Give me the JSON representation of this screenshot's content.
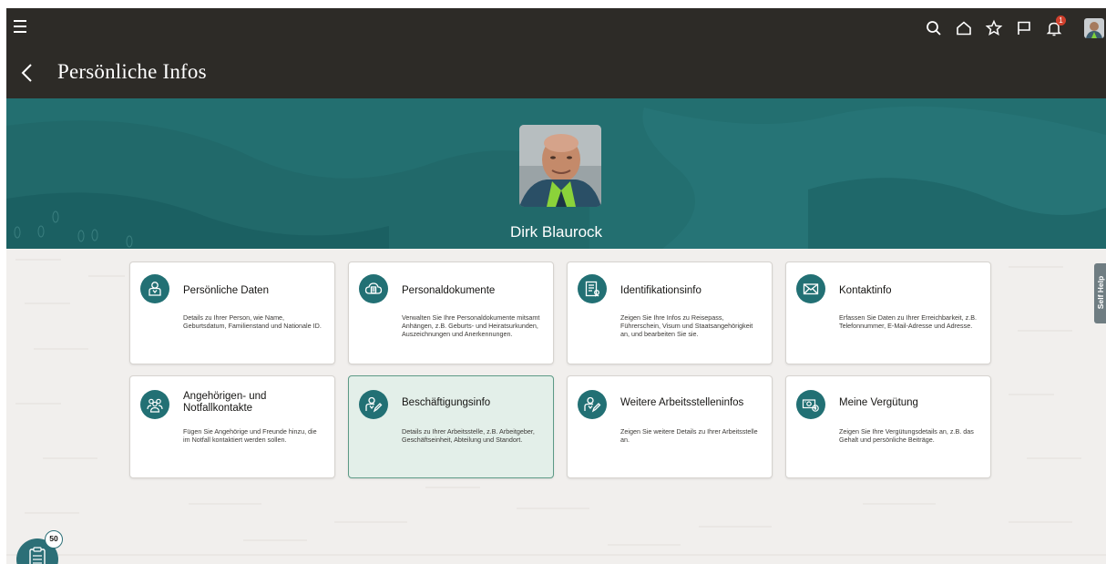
{
  "header": {
    "title": "Persönliche Infos",
    "icons": [
      "menu-icon",
      "search-icon",
      "home-icon",
      "favorite-icon",
      "flag-icon",
      "notifications-icon",
      "user-avatar"
    ],
    "notification_count": "1"
  },
  "profile": {
    "name": "Dirk Blaurock"
  },
  "cards": [
    {
      "title": "Persönliche Daten",
      "desc": "Details zu Ihrer Person, wie Name, Geburtsdatum, Familienstand und Nationale ID.",
      "icon": "person-icon"
    },
    {
      "title": "Personaldokumente",
      "desc": "Verwalten Sie Ihre Personaldokumente mitsamt Anhängen, z.B. Geburts- und Heiratsurkunden, Auszeichnungen und Anerkennungen.",
      "icon": "cloud-document-icon"
    },
    {
      "title": "Identifikationsinfo",
      "desc": "Zeigen Sie Ihre Infos zu Reisepass, Führerschein, Visum und Staatsangehörigkeit an, und bearbeiten Sie sie.",
      "icon": "id-document-icon"
    },
    {
      "title": "Kontaktinfo",
      "desc": "Erfassen Sie Daten zu Ihrer Erreichbarkeit, z.B. Telefonnummer, E-Mail-Adresse und Adresse.",
      "icon": "envelope-icon"
    },
    {
      "title": "Angehörigen- und Notfallkontakte",
      "desc": "Fügen Sie Angehörige und Freunde hinzu, die im Notfall kontaktiert werden sollen.",
      "icon": "people-group-icon"
    },
    {
      "title": "Beschäftigungsinfo",
      "desc": "Details zu Ihrer Arbeitsstelle, z.B. Arbeitgeber, Geschäftseinheit, Abteilung und Standort.",
      "icon": "person-edit-icon",
      "selected": true
    },
    {
      "title": "Weitere Arbeitsstelleninfos",
      "desc": "Zeigen Sie weitere Details zu Ihrer Arbeitsstelle an.",
      "icon": "person-edit-icon"
    },
    {
      "title": "Meine Vergütung",
      "desc": "Zeigen Sie Ihre Vergütungsdetails an, z.B. das Gehalt und persönliche Beiträge.",
      "icon": "money-icon"
    }
  ],
  "self_help": {
    "label": "Self Help"
  },
  "tasks": {
    "count": "50",
    "icon": "task-list-icon"
  },
  "colors": {
    "header": "#2d2b27",
    "banner": "#236f70",
    "icon_circle": "#227074",
    "selected_card": "#e3efe9",
    "badge": "#d0402d"
  }
}
